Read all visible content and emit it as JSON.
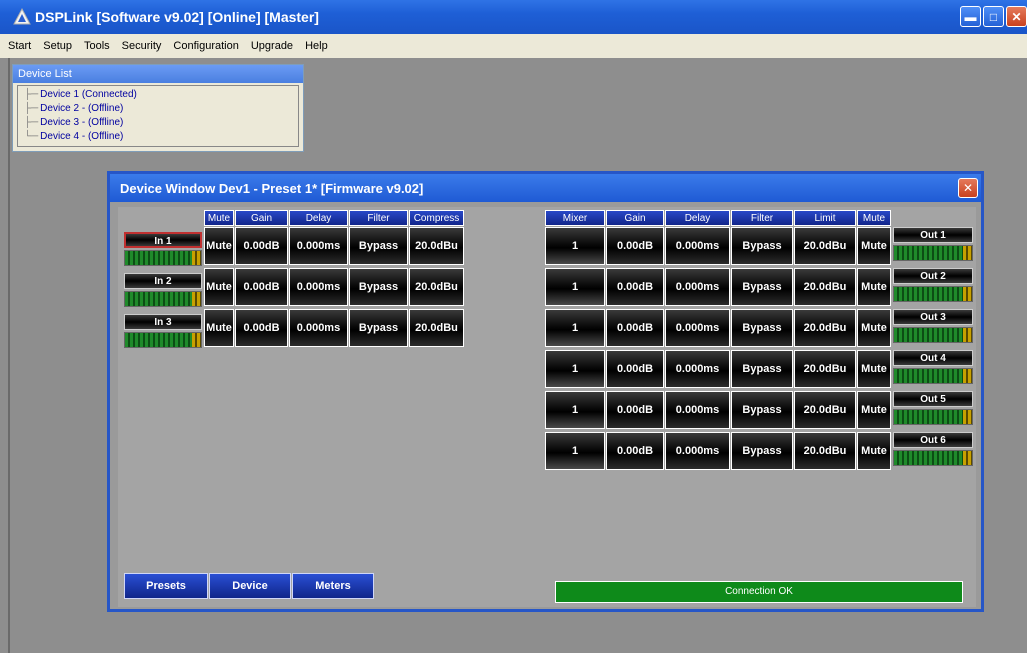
{
  "window": {
    "title": "DSPLink [Software v9.02] [Online] [Master]",
    "controls": [
      "minimize-icon",
      "maximize-icon",
      "close-icon"
    ]
  },
  "menu": [
    "Start",
    "Setup",
    "Tools",
    "Security",
    "Configuration",
    "Upgrade",
    "Help"
  ],
  "device_list": {
    "title": "Device List",
    "items": [
      "Device 1 (Connected)",
      "Device 2 - (Offline)",
      "Device 3 - (Offline)",
      "Device 4 - (Offline)"
    ]
  },
  "device_window": {
    "title": "Device Window Dev1  -  Preset 1*  [Firmware v9.02]",
    "input_headers": [
      "Mute",
      "Gain",
      "Delay",
      "Filter",
      "Compress"
    ],
    "inputs": [
      {
        "name": "In 1",
        "mute": "Mute",
        "gain": "0.00dB",
        "delay": "0.000ms",
        "filter": "Bypass",
        "compress": "20.0dBu",
        "selected": true
      },
      {
        "name": "In 2",
        "mute": "Mute",
        "gain": "0.00dB",
        "delay": "0.000ms",
        "filter": "Bypass",
        "compress": "20.0dBu",
        "selected": false
      },
      {
        "name": "In 3",
        "mute": "Mute",
        "gain": "0.00dB",
        "delay": "0.000ms",
        "filter": "Bypass",
        "compress": "20.0dBu",
        "selected": false
      }
    ],
    "output_headers": [
      "Mixer",
      "Gain",
      "Delay",
      "Filter",
      "Limit",
      "Mute"
    ],
    "outputs": [
      {
        "name": "Out 1",
        "mixer": "1",
        "gain": "0.00dB",
        "delay": "0.000ms",
        "filter": "Bypass",
        "limit": "20.0dBu",
        "mute": "Mute"
      },
      {
        "name": "Out 2",
        "mixer": "1",
        "gain": "0.00dB",
        "delay": "0.000ms",
        "filter": "Bypass",
        "limit": "20.0dBu",
        "mute": "Mute"
      },
      {
        "name": "Out 3",
        "mixer": "1",
        "gain": "0.00dB",
        "delay": "0.000ms",
        "filter": "Bypass",
        "limit": "20.0dBu",
        "mute": "Mute"
      },
      {
        "name": "Out 4",
        "mixer": "1",
        "gain": "0.00dB",
        "delay": "0.000ms",
        "filter": "Bypass",
        "limit": "20.0dBu",
        "mute": "Mute"
      },
      {
        "name": "Out 5",
        "mixer": "1",
        "gain": "0.00dB",
        "delay": "0.000ms",
        "filter": "Bypass",
        "limit": "20.0dBu",
        "mute": "Mute"
      },
      {
        "name": "Out 6",
        "mixer": "1",
        "gain": "0.00dB",
        "delay": "0.000ms",
        "filter": "Bypass",
        "limit": "20.0dBu",
        "mute": "Mute"
      }
    ],
    "tabs": [
      "Presets",
      "Device",
      "Meters"
    ],
    "status": "Connection OK"
  },
  "colors": {
    "titlebar": "#1e5fd6",
    "header_blue": "#12258a",
    "status_green": "#0e8a1a",
    "workspace": "#8e8e8e"
  }
}
